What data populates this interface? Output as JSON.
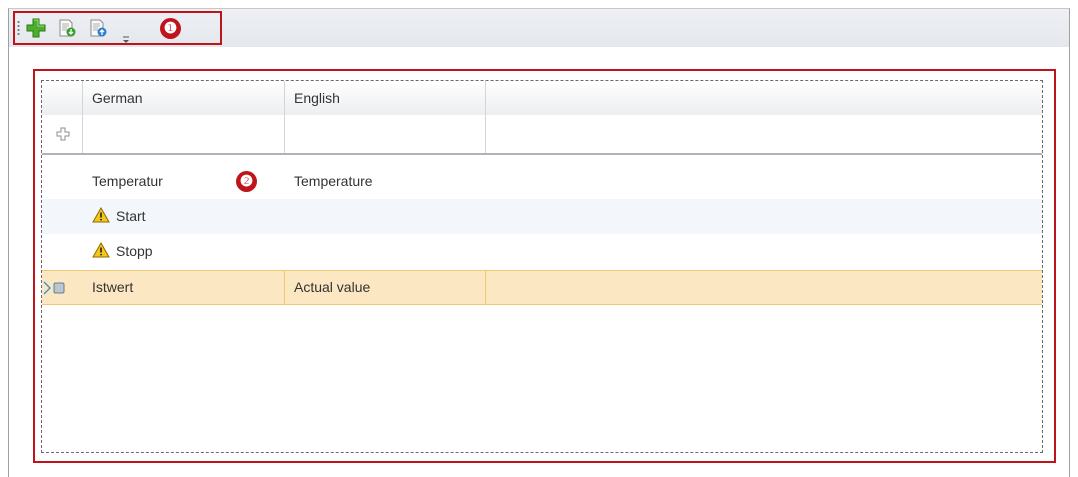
{
  "toolbar": {
    "buttons": [
      {
        "name": "add-language-button",
        "icon": "green-plus-icon"
      },
      {
        "name": "import-button",
        "icon": "document-import-icon"
      },
      {
        "name": "export-button",
        "icon": "document-export-icon"
      }
    ],
    "overflow_icon": "dropdown-arrow-icon",
    "callout": "❶"
  },
  "grid": {
    "columns": [
      "German",
      "English",
      ""
    ],
    "new_row_icon": "plus-outline-icon",
    "callout": "❷",
    "rows": [
      {
        "german": "Temperatur",
        "english": "Temperature",
        "warning": false,
        "selected": false
      },
      {
        "german": "Start",
        "english": "",
        "warning": true,
        "selected": false
      },
      {
        "german": "Stopp",
        "english": "",
        "warning": true,
        "selected": false
      },
      {
        "german": "Istwert",
        "english": "Actual value",
        "warning": false,
        "selected": true
      }
    ]
  },
  "colors": {
    "highlight_frame": "#c0141c",
    "selected_row": "#fbe8c3",
    "alt_row": "#f3f6fa",
    "warning_fill": "#f5c518"
  }
}
